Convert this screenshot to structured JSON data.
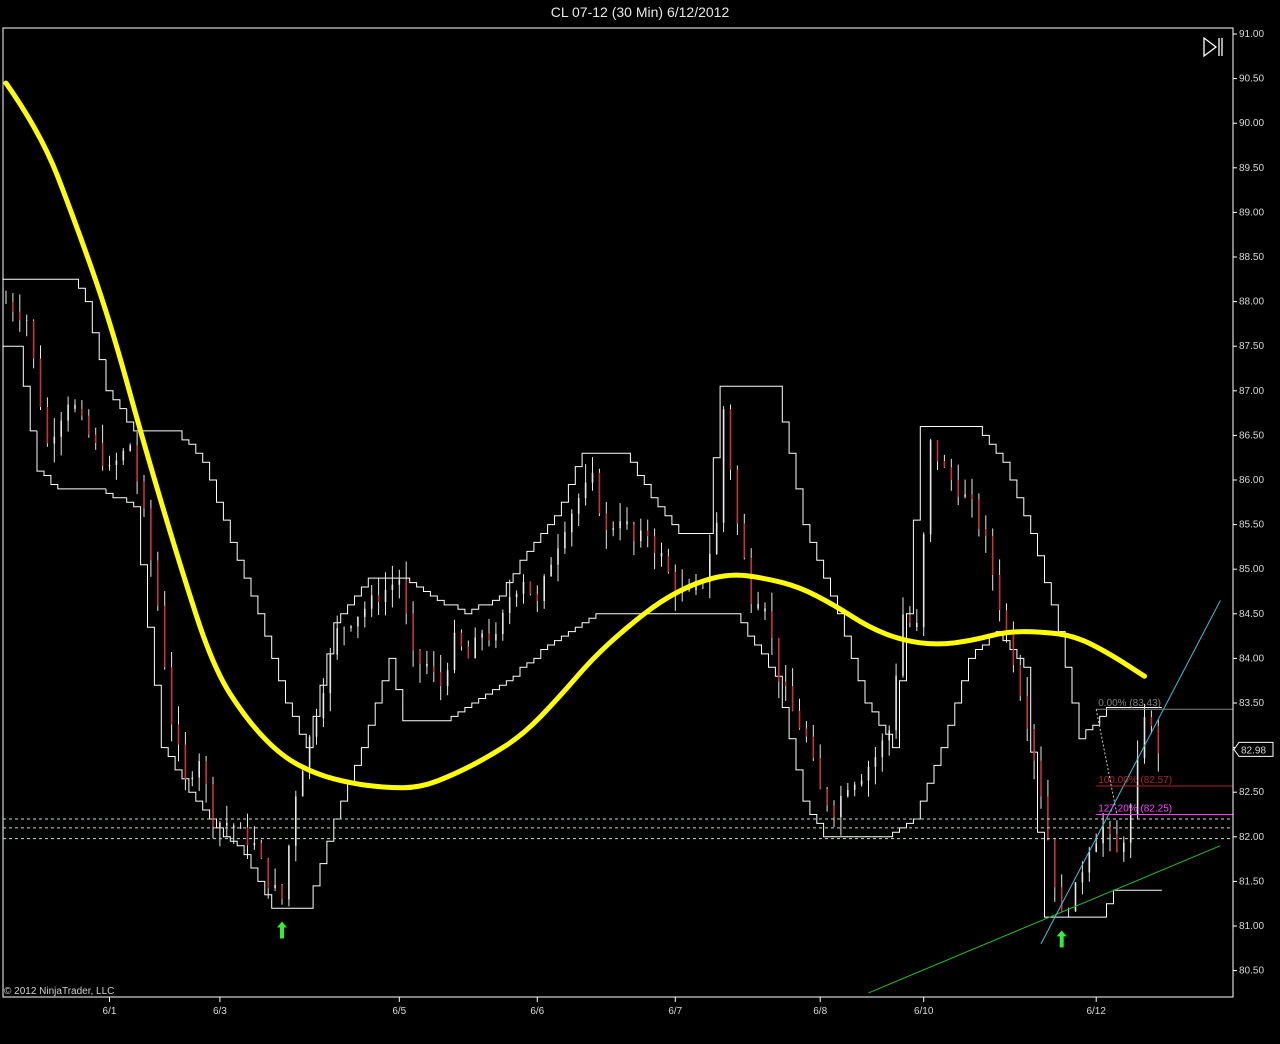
{
  "window": {
    "title": "CL 07-12 (30 Min)  6/12/2012",
    "copyright": "© 2012 NinjaTrader, LLC",
    "play_icon": "play-pause-icon"
  },
  "colors": {
    "background": "#000000",
    "grid_frame": "#ffffff",
    "price_bar": "#e8e8e8",
    "down_bar": "#c83232",
    "envelope": "#ffffff",
    "smooth_line": "#ffff00",
    "fib_zero": "#808080",
    "fib_100": "#b22222",
    "fib_127": "#ff40ff",
    "support_dashed": "#bfe6a8",
    "trend_green": "#22bb22",
    "trend_cyan": "#33c4dd",
    "arrow": "#33ee33",
    "last_price_box": "#ffffff"
  },
  "chart_data": {
    "type": "line",
    "title": "CL 07-12 (30 Min)  6/12/2012",
    "xlabel": "",
    "ylabel": "",
    "ylim": [
      80.25,
      91.0
    ],
    "grid": false,
    "y_ticks": [
      "91.00",
      "90.50",
      "90.00",
      "89.50",
      "89.00",
      "88.50",
      "88.00",
      "87.50",
      "87.00",
      "86.50",
      "86.00",
      "85.50",
      "85.00",
      "84.50",
      "84.00",
      "83.50",
      "83.00",
      "82.50",
      "82.00",
      "81.50",
      "81.00",
      "80.50"
    ],
    "x_ticks": [
      {
        "label": "6/1",
        "i": 15
      },
      {
        "label": "6/3",
        "i": 31
      },
      {
        "label": "6/5",
        "i": 57
      },
      {
        "label": "6/6",
        "i": 77
      },
      {
        "label": "6/7",
        "i": 97
      },
      {
        "label": "6/8",
        "i": 118
      },
      {
        "label": "6/10",
        "i": 133
      },
      {
        "label": "6/12",
        "i": 158
      }
    ],
    "bar_count": 168,
    "last_price": "82.98",
    "close_anchors": [
      [
        0,
        88.0
      ],
      [
        3,
        87.8
      ],
      [
        6,
        86.4
      ],
      [
        9,
        86.9
      ],
      [
        12,
        86.5
      ],
      [
        15,
        86.1
      ],
      [
        18,
        86.4
      ],
      [
        20,
        85.6
      ],
      [
        22,
        84.6
      ],
      [
        24,
        83.3
      ],
      [
        26,
        82.6
      ],
      [
        28,
        82.9
      ],
      [
        30,
        82.2
      ],
      [
        33,
        82.1
      ],
      [
        36,
        81.9
      ],
      [
        38,
        81.5
      ],
      [
        40,
        81.3
      ],
      [
        42,
        82.5
      ],
      [
        45,
        83.4
      ],
      [
        48,
        84.3
      ],
      [
        51,
        84.5
      ],
      [
        54,
        84.7
      ],
      [
        57,
        84.9
      ],
      [
        59,
        84.0
      ],
      [
        61,
        83.9
      ],
      [
        63,
        83.7
      ],
      [
        65,
        84.2
      ],
      [
        67,
        84.0
      ],
      [
        69,
        84.3
      ],
      [
        71,
        84.2
      ],
      [
        73,
        84.7
      ],
      [
        75,
        84.9
      ],
      [
        77,
        84.6
      ],
      [
        79,
        85.1
      ],
      [
        81,
        85.5
      ],
      [
        83,
        85.8
      ],
      [
        85,
        86.0
      ],
      [
        87,
        85.4
      ],
      [
        89,
        85.6
      ],
      [
        91,
        85.3
      ],
      [
        93,
        85.4
      ],
      [
        95,
        85.1
      ],
      [
        97,
        84.8
      ],
      [
        99,
        84.7
      ],
      [
        101,
        84.9
      ],
      [
        103,
        85.5
      ],
      [
        104,
        86.8
      ],
      [
        106,
        85.5
      ],
      [
        108,
        84.7
      ],
      [
        110,
        84.6
      ],
      [
        112,
        83.8
      ],
      [
        114,
        83.4
      ],
      [
        116,
        83.1
      ],
      [
        118,
        82.5
      ],
      [
        120,
        82.3
      ],
      [
        122,
        82.6
      ],
      [
        124,
        82.7
      ],
      [
        126,
        82.9
      ],
      [
        128,
        83.2
      ],
      [
        130,
        84.5
      ],
      [
        132,
        84.3
      ],
      [
        134,
        86.4
      ],
      [
        136,
        86.1
      ],
      [
        138,
        85.9
      ],
      [
        140,
        85.7
      ],
      [
        142,
        85.3
      ],
      [
        144,
        84.6
      ],
      [
        146,
        84.0
      ],
      [
        148,
        83.3
      ],
      [
        150,
        82.5
      ],
      [
        152,
        81.5
      ],
      [
        153,
        81.1
      ],
      [
        155,
        81.4
      ],
      [
        157,
        81.9
      ],
      [
        159,
        82.1
      ],
      [
        161,
        81.8
      ],
      [
        163,
        82.2
      ],
      [
        165,
        83.4
      ],
      [
        167,
        82.98
      ]
    ],
    "envelope_upper": [
      [
        0,
        88.25
      ],
      [
        10,
        88.25
      ],
      [
        12,
        88.0
      ],
      [
        15,
        87.0
      ],
      [
        19,
        86.55
      ],
      [
        25,
        86.55
      ],
      [
        29,
        86.2
      ],
      [
        33,
        85.3
      ],
      [
        37,
        84.5
      ],
      [
        41,
        83.5
      ],
      [
        44,
        83.0
      ],
      [
        48,
        84.4
      ],
      [
        53,
        84.9
      ],
      [
        58,
        84.9
      ],
      [
        62,
        84.7
      ],
      [
        67,
        84.5
      ],
      [
        72,
        84.7
      ],
      [
        76,
        85.2
      ],
      [
        80,
        85.6
      ],
      [
        84,
        86.3
      ],
      [
        90,
        86.3
      ],
      [
        94,
        85.8
      ],
      [
        98,
        85.4
      ],
      [
        102,
        85.4
      ],
      [
        104,
        87.05
      ],
      [
        112,
        87.05
      ],
      [
        116,
        85.5
      ],
      [
        121,
        84.5
      ],
      [
        125,
        83.5
      ],
      [
        129,
        83.0
      ],
      [
        131,
        84.5
      ],
      [
        133,
        86.6
      ],
      [
        141,
        86.6
      ],
      [
        145,
        86.2
      ],
      [
        149,
        85.4
      ],
      [
        153,
        84.3
      ],
      [
        156,
        83.1
      ],
      [
        160,
        83.43
      ],
      [
        164,
        83.43
      ],
      [
        167,
        83.43
      ]
    ],
    "envelope_lower": [
      [
        0,
        87.5
      ],
      [
        2,
        87.5
      ],
      [
        5,
        86.1
      ],
      [
        8,
        85.9
      ],
      [
        14,
        85.9
      ],
      [
        19,
        85.7
      ],
      [
        23,
        83.0
      ],
      [
        27,
        82.5
      ],
      [
        31,
        82.1
      ],
      [
        35,
        81.8
      ],
      [
        39,
        81.2
      ],
      [
        44,
        81.2
      ],
      [
        48,
        82.2
      ],
      [
        52,
        83.0
      ],
      [
        56,
        84.0
      ],
      [
        58,
        83.3
      ],
      [
        64,
        83.3
      ],
      [
        70,
        83.6
      ],
      [
        74,
        83.8
      ],
      [
        78,
        84.1
      ],
      [
        82,
        84.3
      ],
      [
        86,
        84.5
      ],
      [
        92,
        84.5
      ],
      [
        97,
        84.5
      ],
      [
        100,
        84.5
      ],
      [
        106,
        84.5
      ],
      [
        112,
        83.8
      ],
      [
        116,
        82.4
      ],
      [
        119,
        82.0
      ],
      [
        124,
        82.0
      ],
      [
        128,
        82.0
      ],
      [
        132,
        82.2
      ],
      [
        136,
        83.0
      ],
      [
        140,
        84.0
      ],
      [
        144,
        84.3
      ],
      [
        148,
        83.9
      ],
      [
        151,
        81.1
      ],
      [
        156,
        81.1
      ],
      [
        159,
        81.1
      ],
      [
        161,
        81.4
      ],
      [
        165,
        81.4
      ],
      [
        167,
        81.4
      ]
    ],
    "smooth_line": [
      [
        0,
        90.45
      ],
      [
        5,
        89.9
      ],
      [
        10,
        88.9
      ],
      [
        15,
        87.8
      ],
      [
        20,
        86.4
      ],
      [
        25,
        85.1
      ],
      [
        30,
        83.9
      ],
      [
        35,
        83.3
      ],
      [
        40,
        82.9
      ],
      [
        45,
        82.7
      ],
      [
        50,
        82.6
      ],
      [
        55,
        82.55
      ],
      [
        60,
        82.55
      ],
      [
        65,
        82.7
      ],
      [
        70,
        82.9
      ],
      [
        75,
        83.15
      ],
      [
        80,
        83.55
      ],
      [
        85,
        84.0
      ],
      [
        90,
        84.35
      ],
      [
        95,
        84.65
      ],
      [
        100,
        84.85
      ],
      [
        105,
        84.95
      ],
      [
        110,
        84.9
      ],
      [
        115,
        84.8
      ],
      [
        120,
        84.6
      ],
      [
        125,
        84.35
      ],
      [
        130,
        84.2
      ],
      [
        135,
        84.15
      ],
      [
        140,
        84.2
      ],
      [
        145,
        84.3
      ],
      [
        150,
        84.3
      ],
      [
        155,
        84.25
      ],
      [
        160,
        84.05
      ],
      [
        165,
        83.8
      ]
    ],
    "fib_levels": [
      {
        "label": "0.00% (83.43)",
        "value": 83.43,
        "color": "#808080",
        "label_i": 158
      },
      {
        "label": "100.00% (82.57)",
        "value": 82.57,
        "color": "#b22222",
        "label_i": 158
      },
      {
        "label": "127.20% (82.25)",
        "value": 82.25,
        "color": "#ff40ff",
        "label_i": 158
      }
    ],
    "support_dashed": [
      82.2,
      82.1,
      81.98
    ],
    "trend_green": [
      [
        125,
        80.25
      ],
      [
        176,
        81.9
      ]
    ],
    "trend_cyan": [
      [
        150,
        80.8
      ],
      [
        176,
        84.65
      ]
    ],
    "arrows": [
      {
        "i": 40,
        "value": 80.95
      },
      {
        "i": 153,
        "value": 80.85
      }
    ]
  }
}
